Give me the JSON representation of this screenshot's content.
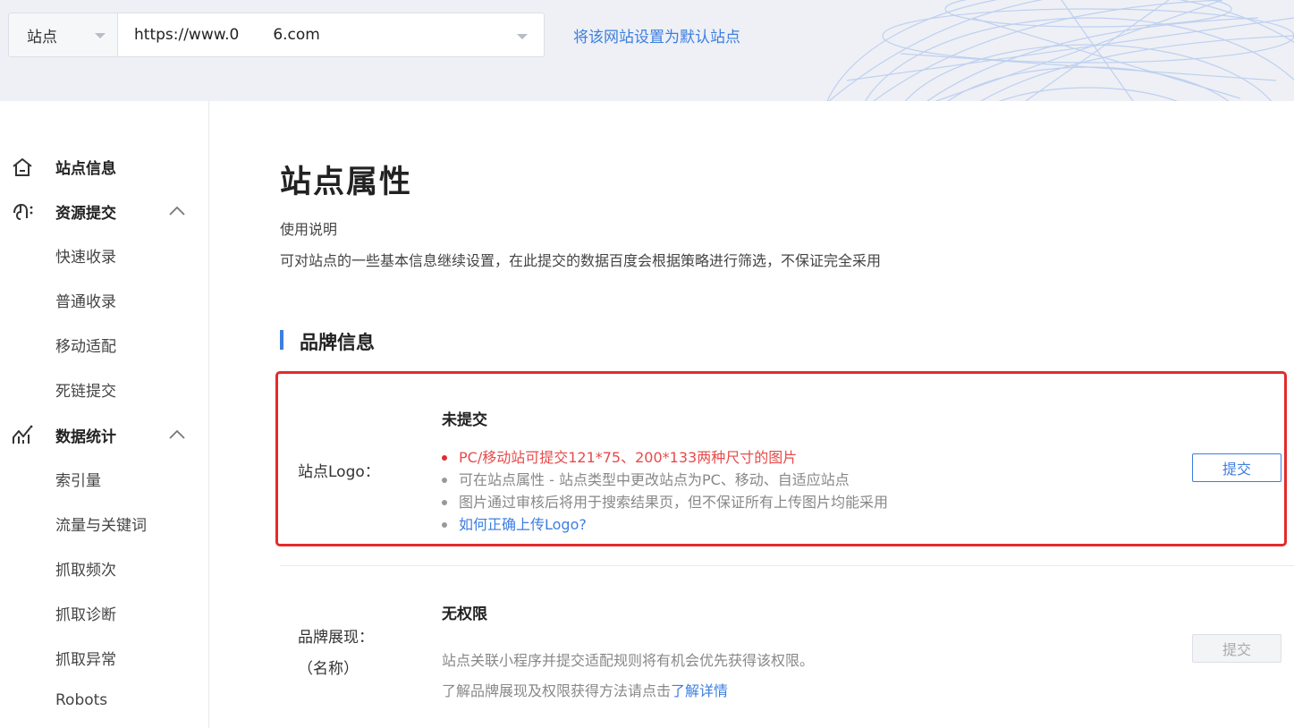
{
  "topbar": {
    "site_label": "站点",
    "url_prefix": "https://www.0",
    "url_suffix": "6.com",
    "set_default_link": "将该网站设置为默认站点"
  },
  "sidebar": {
    "groups": [
      {
        "label": "站点信息",
        "icon": "home-icon"
      },
      {
        "label": "资源提交",
        "icon": "submit-icon",
        "items": [
          "快速收录",
          "普通收录",
          "移动适配",
          "死链提交"
        ]
      },
      {
        "label": "数据统计",
        "icon": "stats-icon",
        "items": [
          "索引量",
          "流量与关键词",
          "抓取频次",
          "抓取诊断",
          "抓取异常",
          "Robots"
        ]
      }
    ]
  },
  "main": {
    "title": "站点属性",
    "usage_title": "使用说明",
    "usage_text": "可对站点的一些基本信息继续设置，在此提交的数据百度会根据策略进行筛选，不保证完全采用",
    "section_title": "品牌信息",
    "logo": {
      "label": "站点Logo：",
      "status": "未提交",
      "bullets": [
        "PC/移动站可提交121*75、200*133两种尺寸的图片",
        "可在站点属性 - 站点类型中更改站点为PC、移动、自适应站点",
        "图片通过审核后将用于搜索结果页，但不保证所有上传图片均能采用",
        "如何正确上传Logo?"
      ],
      "button": "提交"
    },
    "brand": {
      "label_line1": "品牌展现：",
      "label_line2": "（名称）",
      "status": "无权限",
      "desc1": "站点关联小程序并提交适配规则将有机会优先获得该权限。",
      "desc2_prefix": "了解品牌展现及权限获得方法请点击",
      "desc2_link": "了解详情",
      "button": "提交"
    }
  },
  "colors": {
    "accent": "#3d7ee0",
    "highlight_border": "#e32b2b",
    "warning_text": "#e84a4a"
  }
}
